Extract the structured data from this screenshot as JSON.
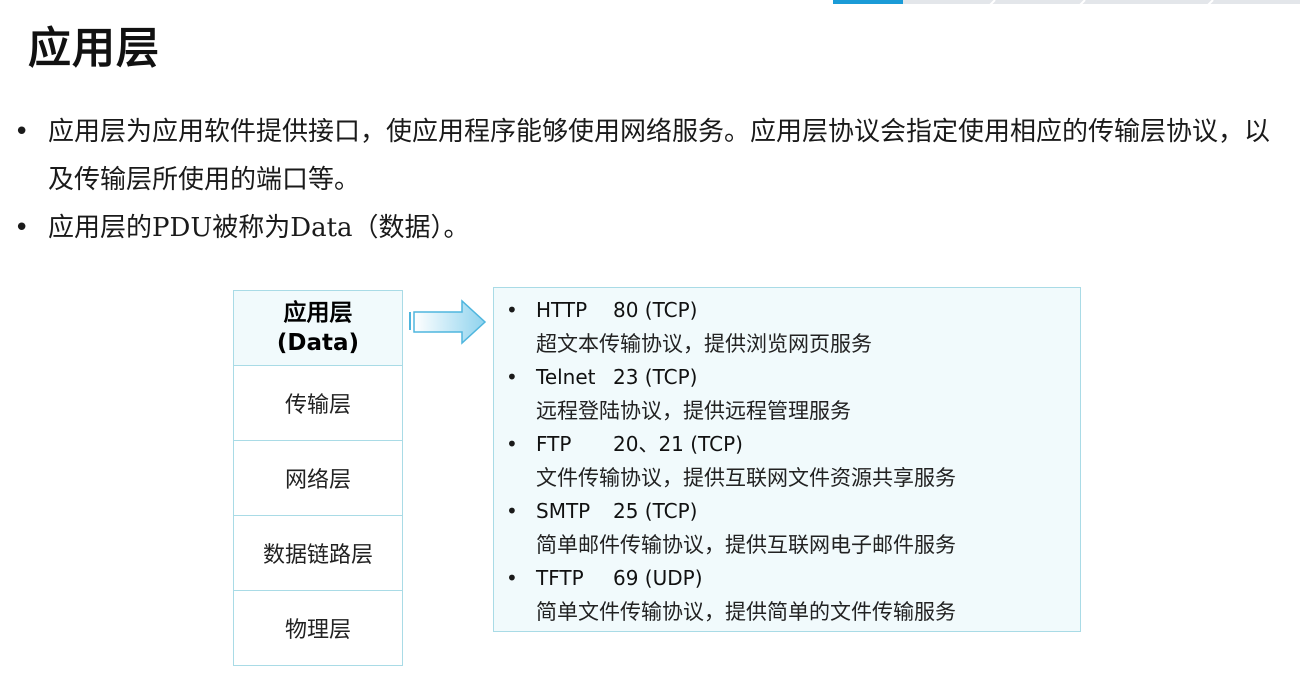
{
  "colors": {
    "accent": "#1a9bd7",
    "box_border": "#a9dbe6",
    "box_fill": "#f1fafc"
  },
  "title": "应用层",
  "bullets": [
    "应用层为应用软件提供接口，使应用程序能够使用网络服务。应用层协议会指定使用相应的传输层协议，以及传输层所使用的端口等。",
    "应用层的PDU被称为Data（数据）。"
  ],
  "layers": {
    "application": {
      "name": "应用层",
      "pdu": "(Data)"
    },
    "transport": "传输层",
    "network": "网络层",
    "datalink": "数据链路层",
    "physical": "物理层"
  },
  "protocols": [
    {
      "name": "HTTP",
      "port": "80 (TCP)",
      "desc": "超文本传输协议，提供浏览网页服务"
    },
    {
      "name": "Telnet",
      "port": "23 (TCP)",
      "desc": "远程登陆协议，提供远程管理服务"
    },
    {
      "name": "FTP",
      "port": "20、21 (TCP)",
      "desc": "文件传输协议，提供互联网文件资源共享服务"
    },
    {
      "name": "SMTP",
      "port": "25 (TCP)",
      "desc": "简单邮件传输协议，提供互联网电子邮件服务"
    },
    {
      "name": "TFTP",
      "port": "69 (UDP)",
      "desc": "简单文件传输协议，提供简单的文件传输服务"
    }
  ]
}
